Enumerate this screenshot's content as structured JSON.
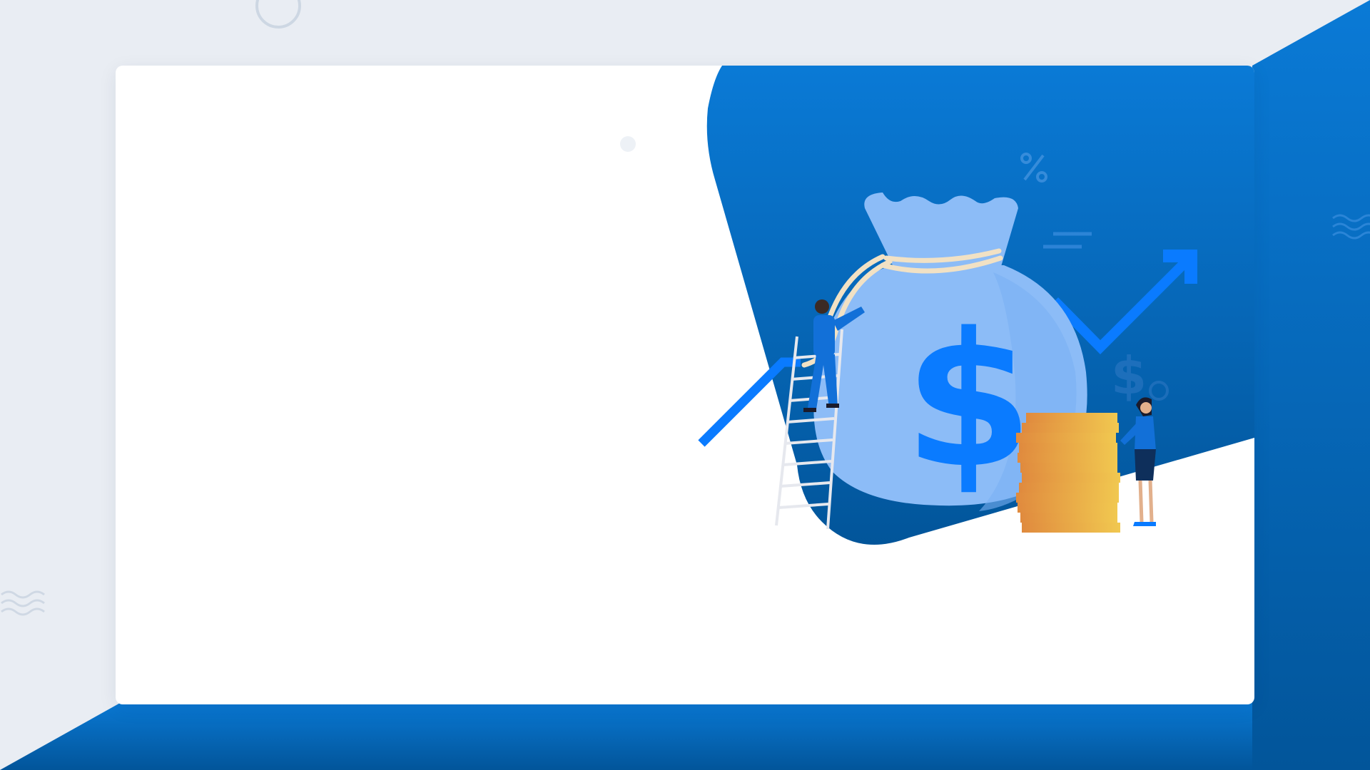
{
  "colors": {
    "page_background": "#e9edf3",
    "card_background": "#ffffff",
    "primary_blue": "#0a7ad6",
    "dark_blue": "#02559a",
    "bright_blue": "#0a7bff",
    "light_blue_bag": "#8cbcf7",
    "coin_gold": "#e8a540",
    "rope_cream": "#f1e1c4"
  },
  "illustration": {
    "subject": "money-bag-growth",
    "icons": [
      "dollar-sign-icon",
      "percent-icon",
      "trend-up-arrow-icon",
      "coin-stack-icon",
      "ladder-icon"
    ]
  }
}
